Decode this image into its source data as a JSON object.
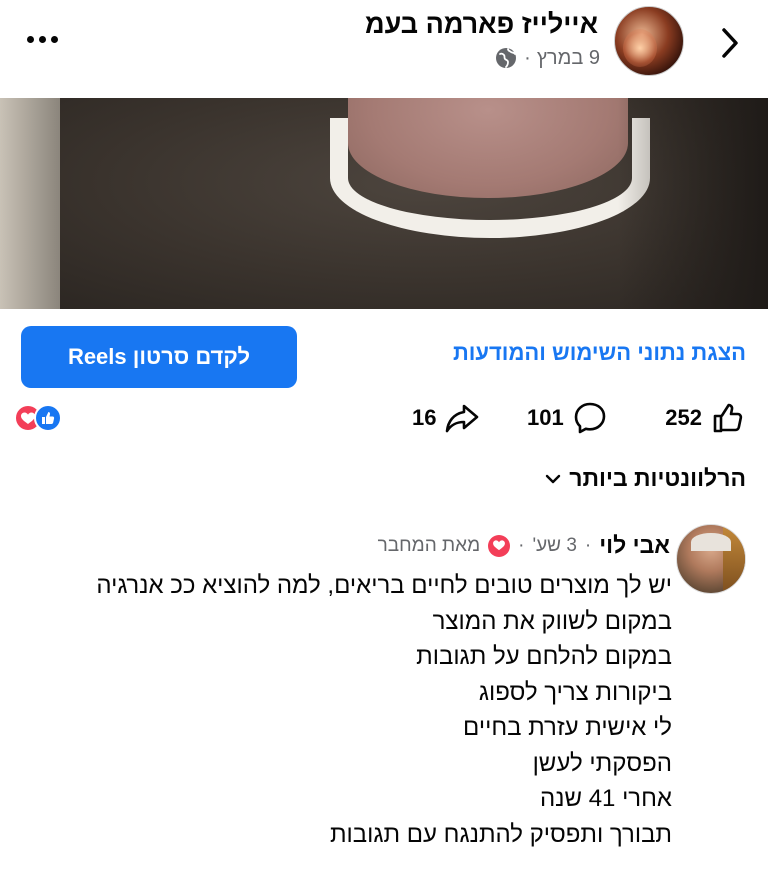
{
  "header": {
    "page_name": "איילייז פארמה בעמ",
    "post_date": "9 במרץ",
    "separator": "·",
    "privacy_icon": "globe-icon",
    "back_icon": "chevron-right-icon",
    "more_icon": "more-horizontal-icon"
  },
  "actions": {
    "insights_link": "הצגת נתוני השימוש והמודעות",
    "boost_button": "לקדם סרטון Reels"
  },
  "stats": {
    "likes": "252",
    "comments": "101",
    "shares": "16",
    "reaction_types": [
      "like",
      "love"
    ]
  },
  "sort": {
    "label": "הרלוונטיות ביותר"
  },
  "comment": {
    "author": "אבי לוי",
    "time": "3 שע'",
    "separator": "·",
    "author_badge": "מאת המחבר",
    "lines": [
      "יש לך מוצרים טובים לחיים בריאים, למה להוציא ככ אנרגיה",
      "במקום לשווק את המוצר",
      "במקום להלחם על תגובות",
      "ביקורות צריך לספוג",
      "לי אישית עזרת בחיים",
      "הפסקתי לעשן",
      "אחרי 41 שנה",
      "תבורך ותפסיק להתנגח עם תגובות"
    ]
  },
  "colors": {
    "accent": "#1877f2",
    "love": "#f33e58",
    "muted_text": "#65676b",
    "text": "#050505"
  }
}
